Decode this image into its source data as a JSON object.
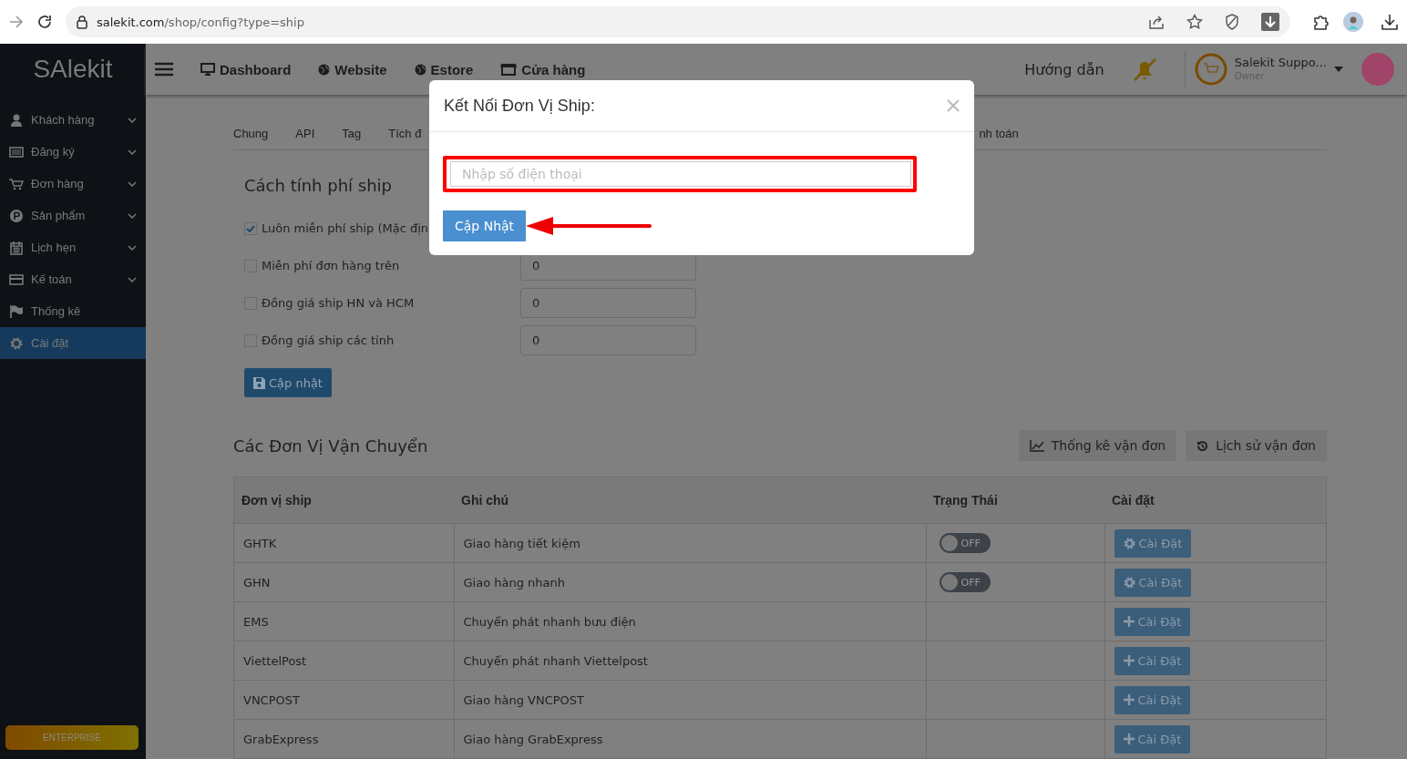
{
  "browser": {
    "url_host": "salekit.com",
    "url_path": "/shop/config?type=ship"
  },
  "sidebar": {
    "logo": "SAlekit",
    "items": [
      {
        "label": "Khách hàng",
        "kind": "user",
        "has_submenu": true,
        "selected": false
      },
      {
        "label": "Đăng ký",
        "kind": "list",
        "has_submenu": true,
        "selected": false
      },
      {
        "label": "Đơn hàng",
        "kind": "cart",
        "has_submenu": true,
        "selected": false
      },
      {
        "label": "Sản phẩm",
        "kind": "p",
        "has_submenu": true,
        "selected": false
      },
      {
        "label": "Lịch hẹn",
        "kind": "calendar",
        "has_submenu": true,
        "selected": false
      },
      {
        "label": "Kế toán",
        "kind": "card",
        "has_submenu": true,
        "selected": false
      },
      {
        "label": "Thống kê",
        "kind": "flag",
        "has_submenu": false,
        "selected": false
      },
      {
        "label": "Cài đặt",
        "kind": "gear",
        "has_submenu": false,
        "selected": true
      }
    ],
    "plan": "ENTERPRISE"
  },
  "topbar": {
    "nav": [
      {
        "label": "Dashboard",
        "kind": "monitor"
      },
      {
        "label": "Website",
        "kind": "globe"
      },
      {
        "label": "Estore",
        "kind": "globe"
      },
      {
        "label": "Cửa hàng",
        "kind": "store"
      }
    ],
    "guide": "Hướng dẫn",
    "user_name": "Salekit Suppo...",
    "user_role": "Owner"
  },
  "tabs": [
    {
      "label": "Chung",
      "selected": false
    },
    {
      "label": "API",
      "selected": false
    },
    {
      "label": "Tag",
      "selected": false
    },
    {
      "label": "Tích đ",
      "selected": false
    },
    {
      "label": "nh toán",
      "selected": false
    }
  ],
  "fee_section": {
    "title": "Cách tính phí ship",
    "options": [
      {
        "label": "Luôn miễn phí ship (Mặc địn",
        "checked": true
      },
      {
        "label": "Miễn phí đơn hàng trên",
        "checked": false,
        "value": "0"
      },
      {
        "label": "Đồng giá ship HN và HCM",
        "checked": false,
        "value": "0"
      },
      {
        "label": "Đồng giá ship các tỉnh",
        "checked": false,
        "value": "0"
      }
    ],
    "button": "Cập nhật"
  },
  "carriers": {
    "title": "Các Đơn Vị Vận Chuyển",
    "actions": [
      {
        "label": "Thống kê vận đơn",
        "kind": "chart"
      },
      {
        "label": "Lịch sử vận đơn",
        "kind": "history"
      }
    ],
    "columns": [
      "Đơn vị ship",
      "Ghi chú",
      "Trạng Thái",
      "Cài đặt"
    ],
    "rows": [
      {
        "name": "GHTK",
        "note": "Giao hàng tiết kiệm",
        "toggle": {
          "on": false,
          "label": "OFF"
        },
        "setting": {
          "kind": "gear",
          "label": "Cài Đặt"
        }
      },
      {
        "name": "GHN",
        "note": "Giao hàng nhanh",
        "toggle": {
          "on": false,
          "label": "OFF"
        },
        "setting": {
          "kind": "gear",
          "label": "Cài Đặt"
        }
      },
      {
        "name": "EMS",
        "note": "Chuyển phát nhanh bưu điện",
        "setting": {
          "kind": "plus",
          "label": "Cài Đặt"
        }
      },
      {
        "name": "ViettelPost",
        "note": "Chuyển phát nhanh Viettelpost",
        "setting": {
          "kind": "plus",
          "label": "Cài Đặt"
        }
      },
      {
        "name": "VNCPOST",
        "note": "Giao hàng VNCPOST",
        "setting": {
          "kind": "plus",
          "label": "Cài Đặt"
        }
      },
      {
        "name": "GrabExpress",
        "note": "Giao hàng GrabExpress",
        "setting": {
          "kind": "plus",
          "label": "Cài Đặt"
        }
      }
    ]
  },
  "modal": {
    "title": "Kết Nối Đơn Vị Ship:",
    "placeholder": "Nhập số điện thoại",
    "button": "Cập Nhật"
  }
}
